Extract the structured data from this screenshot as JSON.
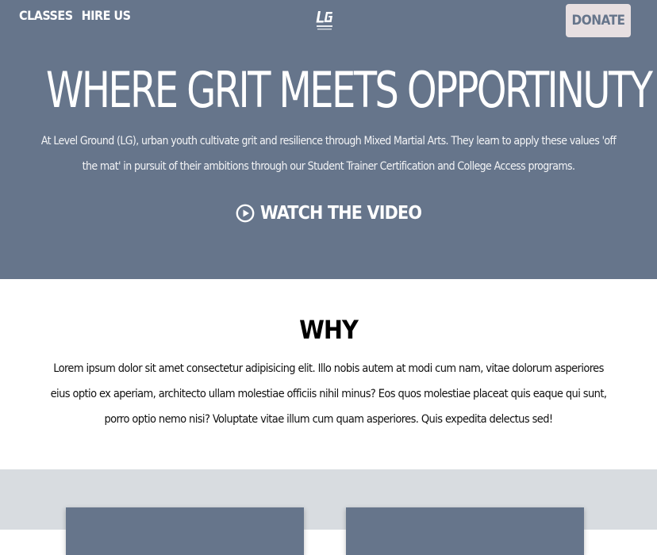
{
  "nav": {
    "links": [
      "CLASSES",
      "HIRE US"
    ],
    "logo_text": "LG",
    "logo_subtext": "LEVEL GROUND",
    "donate_label": "DONATE"
  },
  "hero": {
    "title": "WHERE GRIT MEETS OPPORTINUTY",
    "description": "At Level Ground (LG), urban youth cultivate grit and resilience through Mixed Martial Arts. They learn to apply these values 'off the mat' in pursuit of their ambitions through our Student Trainer Certification and College Access programs.",
    "watch_label": "WATCH THE VIDEO",
    "watch_icon": "play-circle-icon"
  },
  "why": {
    "title": "WHY",
    "body": "Lorem ipsum dolor sit amet consectetur adipisicing elit. Illo nobis autem at modi cum nam, vitae dolorum asperiores eius optio ex aperiam, architecto ullam molestiae officiis nihil minus? Eos quos molestiae placeat quis eaque qui sunt, porro optio nemo nisi? Voluptate vitae illum cum quam asperiores. Quis expedita delectus sed!"
  },
  "colors": {
    "hero_bg": "#66758b",
    "donate_bg": "#e7dfe1",
    "cards_section_bg": "#d8dce0",
    "card_bg": "#66758b"
  }
}
